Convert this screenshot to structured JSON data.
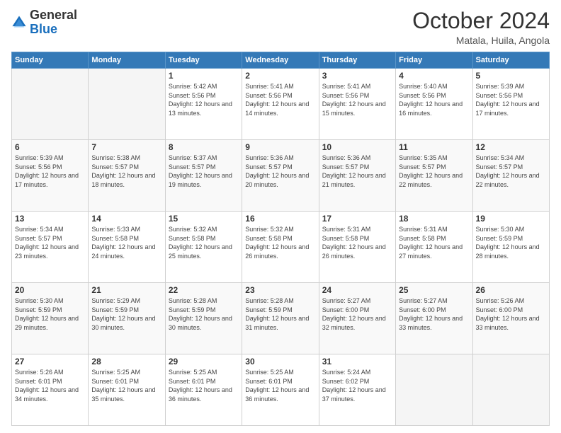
{
  "header": {
    "logo_general": "General",
    "logo_blue": "Blue",
    "month_title": "October 2024",
    "subtitle": "Matala, Huila, Angola"
  },
  "days_of_week": [
    "Sunday",
    "Monday",
    "Tuesday",
    "Wednesday",
    "Thursday",
    "Friday",
    "Saturday"
  ],
  "weeks": [
    [
      {
        "day": "",
        "info": ""
      },
      {
        "day": "",
        "info": ""
      },
      {
        "day": "1",
        "info": "Sunrise: 5:42 AM\nSunset: 5:56 PM\nDaylight: 12 hours\nand 13 minutes."
      },
      {
        "day": "2",
        "info": "Sunrise: 5:41 AM\nSunset: 5:56 PM\nDaylight: 12 hours\nand 14 minutes."
      },
      {
        "day": "3",
        "info": "Sunrise: 5:41 AM\nSunset: 5:56 PM\nDaylight: 12 hours\nand 15 minutes."
      },
      {
        "day": "4",
        "info": "Sunrise: 5:40 AM\nSunset: 5:56 PM\nDaylight: 12 hours\nand 16 minutes."
      },
      {
        "day": "5",
        "info": "Sunrise: 5:39 AM\nSunset: 5:56 PM\nDaylight: 12 hours\nand 17 minutes."
      }
    ],
    [
      {
        "day": "6",
        "info": "Sunrise: 5:39 AM\nSunset: 5:56 PM\nDaylight: 12 hours\nand 17 minutes."
      },
      {
        "day": "7",
        "info": "Sunrise: 5:38 AM\nSunset: 5:57 PM\nDaylight: 12 hours\nand 18 minutes."
      },
      {
        "day": "8",
        "info": "Sunrise: 5:37 AM\nSunset: 5:57 PM\nDaylight: 12 hours\nand 19 minutes."
      },
      {
        "day": "9",
        "info": "Sunrise: 5:36 AM\nSunset: 5:57 PM\nDaylight: 12 hours\nand 20 minutes."
      },
      {
        "day": "10",
        "info": "Sunrise: 5:36 AM\nSunset: 5:57 PM\nDaylight: 12 hours\nand 21 minutes."
      },
      {
        "day": "11",
        "info": "Sunrise: 5:35 AM\nSunset: 5:57 PM\nDaylight: 12 hours\nand 22 minutes."
      },
      {
        "day": "12",
        "info": "Sunrise: 5:34 AM\nSunset: 5:57 PM\nDaylight: 12 hours\nand 22 minutes."
      }
    ],
    [
      {
        "day": "13",
        "info": "Sunrise: 5:34 AM\nSunset: 5:57 PM\nDaylight: 12 hours\nand 23 minutes."
      },
      {
        "day": "14",
        "info": "Sunrise: 5:33 AM\nSunset: 5:58 PM\nDaylight: 12 hours\nand 24 minutes."
      },
      {
        "day": "15",
        "info": "Sunrise: 5:32 AM\nSunset: 5:58 PM\nDaylight: 12 hours\nand 25 minutes."
      },
      {
        "day": "16",
        "info": "Sunrise: 5:32 AM\nSunset: 5:58 PM\nDaylight: 12 hours\nand 26 minutes."
      },
      {
        "day": "17",
        "info": "Sunrise: 5:31 AM\nSunset: 5:58 PM\nDaylight: 12 hours\nand 26 minutes."
      },
      {
        "day": "18",
        "info": "Sunrise: 5:31 AM\nSunset: 5:58 PM\nDaylight: 12 hours\nand 27 minutes."
      },
      {
        "day": "19",
        "info": "Sunrise: 5:30 AM\nSunset: 5:59 PM\nDaylight: 12 hours\nand 28 minutes."
      }
    ],
    [
      {
        "day": "20",
        "info": "Sunrise: 5:30 AM\nSunset: 5:59 PM\nDaylight: 12 hours\nand 29 minutes."
      },
      {
        "day": "21",
        "info": "Sunrise: 5:29 AM\nSunset: 5:59 PM\nDaylight: 12 hours\nand 30 minutes."
      },
      {
        "day": "22",
        "info": "Sunrise: 5:28 AM\nSunset: 5:59 PM\nDaylight: 12 hours\nand 30 minutes."
      },
      {
        "day": "23",
        "info": "Sunrise: 5:28 AM\nSunset: 5:59 PM\nDaylight: 12 hours\nand 31 minutes."
      },
      {
        "day": "24",
        "info": "Sunrise: 5:27 AM\nSunset: 6:00 PM\nDaylight: 12 hours\nand 32 minutes."
      },
      {
        "day": "25",
        "info": "Sunrise: 5:27 AM\nSunset: 6:00 PM\nDaylight: 12 hours\nand 33 minutes."
      },
      {
        "day": "26",
        "info": "Sunrise: 5:26 AM\nSunset: 6:00 PM\nDaylight: 12 hours\nand 33 minutes."
      }
    ],
    [
      {
        "day": "27",
        "info": "Sunrise: 5:26 AM\nSunset: 6:01 PM\nDaylight: 12 hours\nand 34 minutes."
      },
      {
        "day": "28",
        "info": "Sunrise: 5:25 AM\nSunset: 6:01 PM\nDaylight: 12 hours\nand 35 minutes."
      },
      {
        "day": "29",
        "info": "Sunrise: 5:25 AM\nSunset: 6:01 PM\nDaylight: 12 hours\nand 36 minutes."
      },
      {
        "day": "30",
        "info": "Sunrise: 5:25 AM\nSunset: 6:01 PM\nDaylight: 12 hours\nand 36 minutes."
      },
      {
        "day": "31",
        "info": "Sunrise: 5:24 AM\nSunset: 6:02 PM\nDaylight: 12 hours\nand 37 minutes."
      },
      {
        "day": "",
        "info": ""
      },
      {
        "day": "",
        "info": ""
      }
    ]
  ]
}
